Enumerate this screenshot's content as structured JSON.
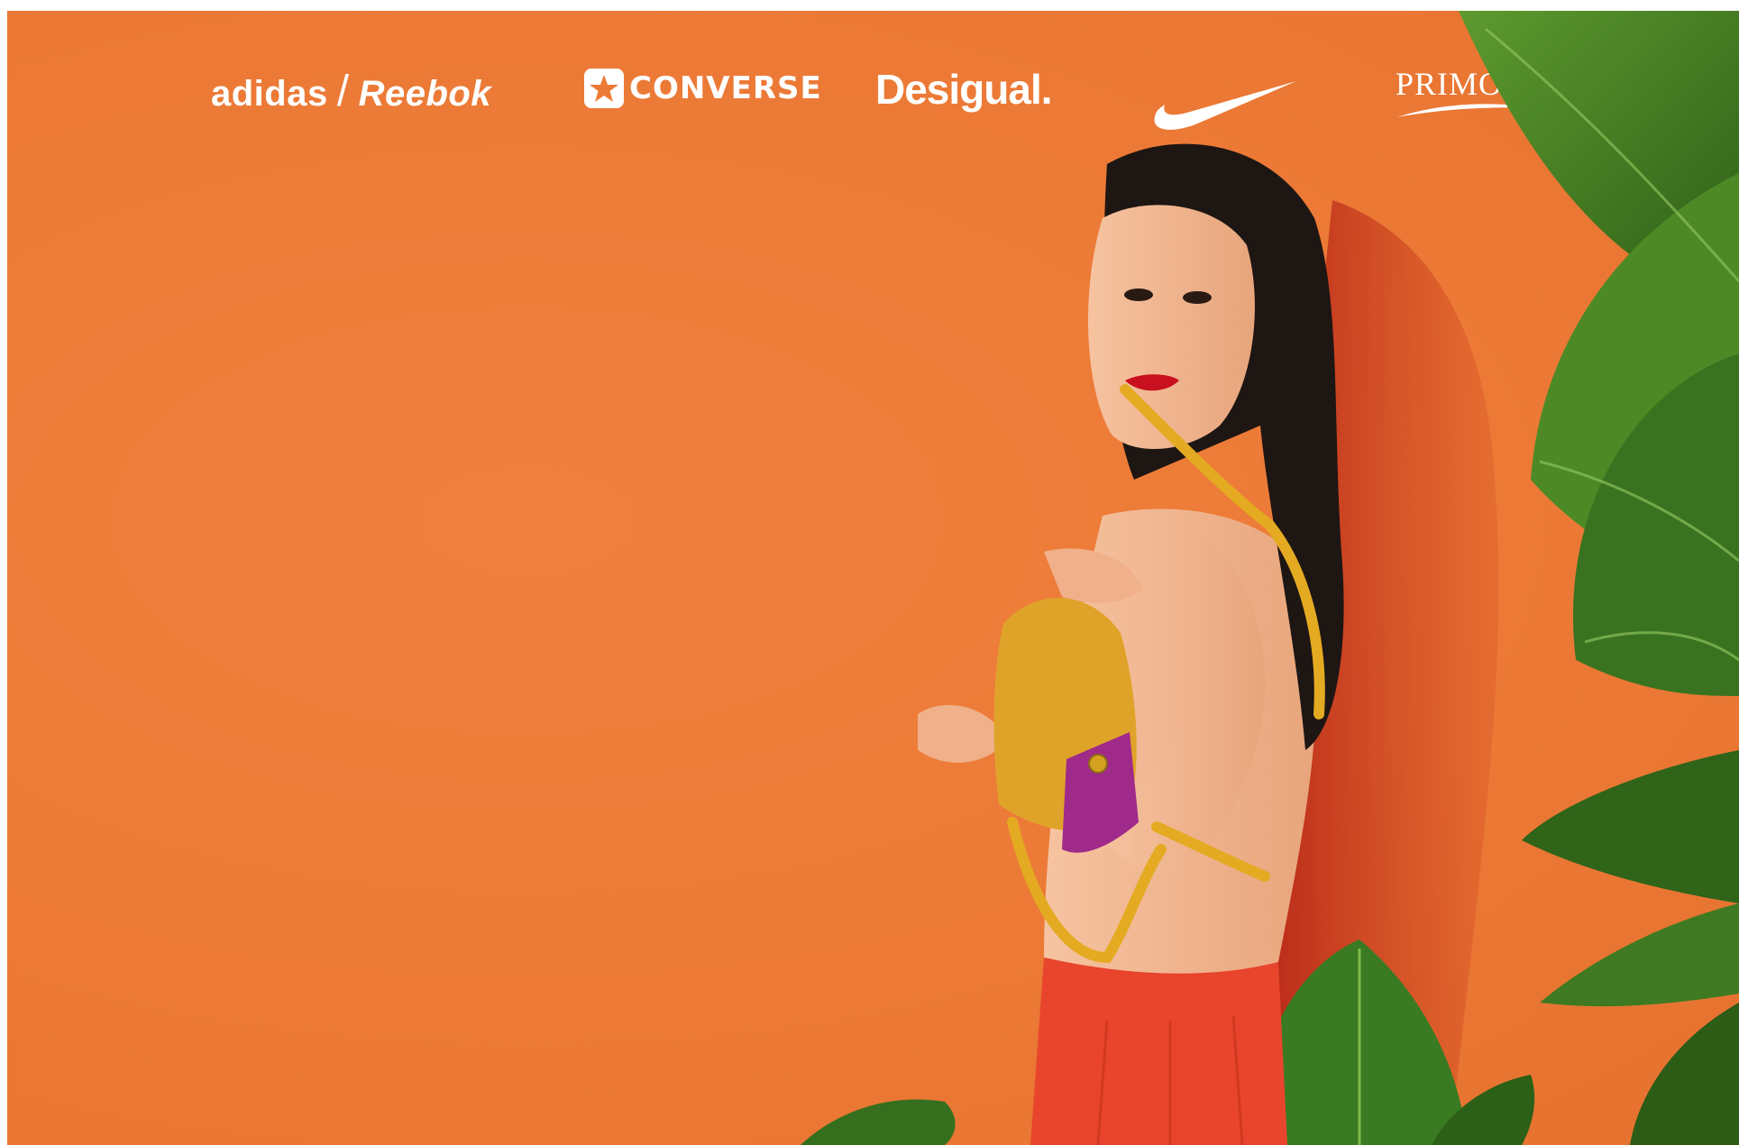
{
  "logos": {
    "adidas": "adidas",
    "slash": "/",
    "reebok": "Reebok",
    "converse": "CONVERSE",
    "desigual": "Desigual.",
    "nike_icon": "nike-swoosh-icon",
    "primor": "PRIMOR"
  },
  "colors": {
    "background": "#ec7a36",
    "leaf": "#3f7a22",
    "bag": "#e0a32a",
    "bag_accent": "#a02a8a",
    "skirt": "#e8452c",
    "hair": "#1e1613",
    "skin": "#f2b38c"
  }
}
